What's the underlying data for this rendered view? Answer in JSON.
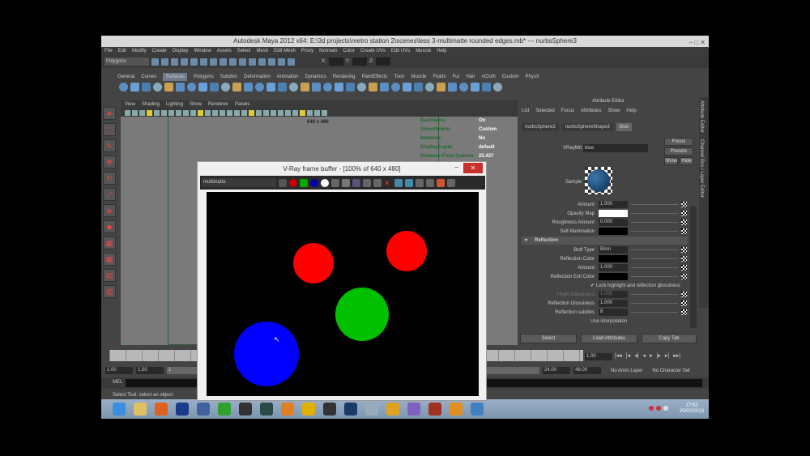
{
  "window": {
    "title": "Autodesk Maya 2012 x64: E:\\3d projects\\metro station 2\\scenes\\less 3-multimatte rounded edges.mb*  ---  nurbsSphere3",
    "controls": "–  □  ✕"
  },
  "menu": [
    "File",
    "Edit",
    "Modify",
    "Create",
    "Display",
    "Window",
    "Assets",
    "Select",
    "Mesh",
    "Edit Mesh",
    "Proxy",
    "Normals",
    "Color",
    "Create UVs",
    "Edit UVs",
    "Muscle",
    "Help"
  ],
  "toolbar": {
    "mode": "Polygons",
    "x_label": "X:",
    "y_label": "Y:",
    "z_label": "Z:"
  },
  "shelf_tabs": [
    "General",
    "Curves",
    "Surfaces",
    "Polygons",
    "Subdivs",
    "Deformation",
    "Animation",
    "Dynamics",
    "Rendering",
    "PaintEffects",
    "Toon",
    "Muscle",
    "Fluids",
    "Fur",
    "Hair",
    "nCloth",
    "Custom",
    "PhysX"
  ],
  "shelf_active": "Surfaces",
  "panel_menu": [
    "View",
    "Shading",
    "Lighting",
    "Show",
    "Renderer",
    "Panels"
  ],
  "viewport": {
    "resolution": "640 x 480",
    "hud": [
      {
        "k": "Backfaces:",
        "v": "On"
      },
      {
        "k": "Smoothness:",
        "v": "Custom"
      },
      {
        "k": "Instance:",
        "v": "No"
      },
      {
        "k": "Display Layer:",
        "v": "default"
      },
      {
        "k": "Distance From Camera:",
        "v": "25.437"
      }
    ]
  },
  "attr_editor": {
    "title": "Attribute Editor",
    "menu": [
      "List",
      "Selected",
      "Focus",
      "Attributes",
      "Show",
      "Help"
    ],
    "tabs": [
      "nurbsSphere3",
      "nurbsSphereShape3",
      "blue"
    ],
    "node_label": "VRayMtl:",
    "node_name": "blue",
    "focus": "Focus",
    "presets": "Presets",
    "show": "Show",
    "hide": "Hide",
    "sample_label": "Sample",
    "rows": [
      {
        "label": "Amount",
        "value": "1.000",
        "type": "num"
      },
      {
        "label": "Opacity Map",
        "value": "",
        "type": "white"
      },
      {
        "label": "Roughness Amount",
        "value": "0.000",
        "type": "num"
      },
      {
        "label": "Self-Illumination",
        "value": "",
        "type": "black"
      }
    ],
    "section": "Reflection",
    "rows2": [
      {
        "label": "Brdf Type",
        "value": "Blinn",
        "type": "num"
      },
      {
        "label": "Reflection Color",
        "value": "",
        "type": "black"
      },
      {
        "label": "Amount",
        "value": "1.000",
        "type": "num"
      },
      {
        "label": "Reflection Exit Color",
        "value": "",
        "type": "black"
      },
      {
        "label": "",
        "value": "✔ Lock highlight and reflection glossiness",
        "type": "check"
      },
      {
        "label": "Hlight Glossiness",
        "value": "1.000",
        "type": "dim"
      },
      {
        "label": "Reflection Glossiness",
        "value": "1.000",
        "type": "num"
      },
      {
        "label": "Reflection subdivs",
        "value": "8",
        "type": "num"
      },
      {
        "label": "",
        "value": "Use interpolation",
        "type": "check"
      }
    ],
    "buttons": [
      "Select",
      "Load Attributes",
      "Copy Tab"
    ]
  },
  "side_tabs": [
    "Attribute Editor",
    "Channel Box / Layer Editor"
  ],
  "timeline": {
    "current": "1.00",
    "start": "1.00",
    "start2": "1.00",
    "frame": "1",
    "end": "24.00",
    "end2": "48.00",
    "anim_layer": "No Anim Layer",
    "char_set": "No Character Set",
    "controls": [
      "|◂◂",
      "|◂",
      "◂|",
      "◂",
      "▸",
      "|▸",
      "▸|",
      "▸▸|"
    ]
  },
  "mel": {
    "label": "MEL"
  },
  "help_line": "Select Tool: select an object",
  "taskbar": {
    "apps": [
      "internet-explorer",
      "file-explorer",
      "firefox",
      "photoshop",
      "monitor",
      "green-app",
      "maya",
      "nuke",
      "blender",
      "nuke-radiation",
      "7zip",
      "fc3",
      "pen-tool",
      "app-yellow",
      "visual-studio",
      "portrait",
      "media-player",
      "photo-viewer"
    ],
    "time": "17:52",
    "date": "25/02/2013"
  },
  "vray": {
    "title": "V-Ray frame buffer - [100% of 640 x 480]",
    "channel": "multimatte",
    "circles": [
      {
        "color": "#ff0000"
      },
      {
        "color": "#ff0000"
      },
      {
        "color": "#00c000"
      },
      {
        "color": "#0000ff"
      }
    ]
  }
}
